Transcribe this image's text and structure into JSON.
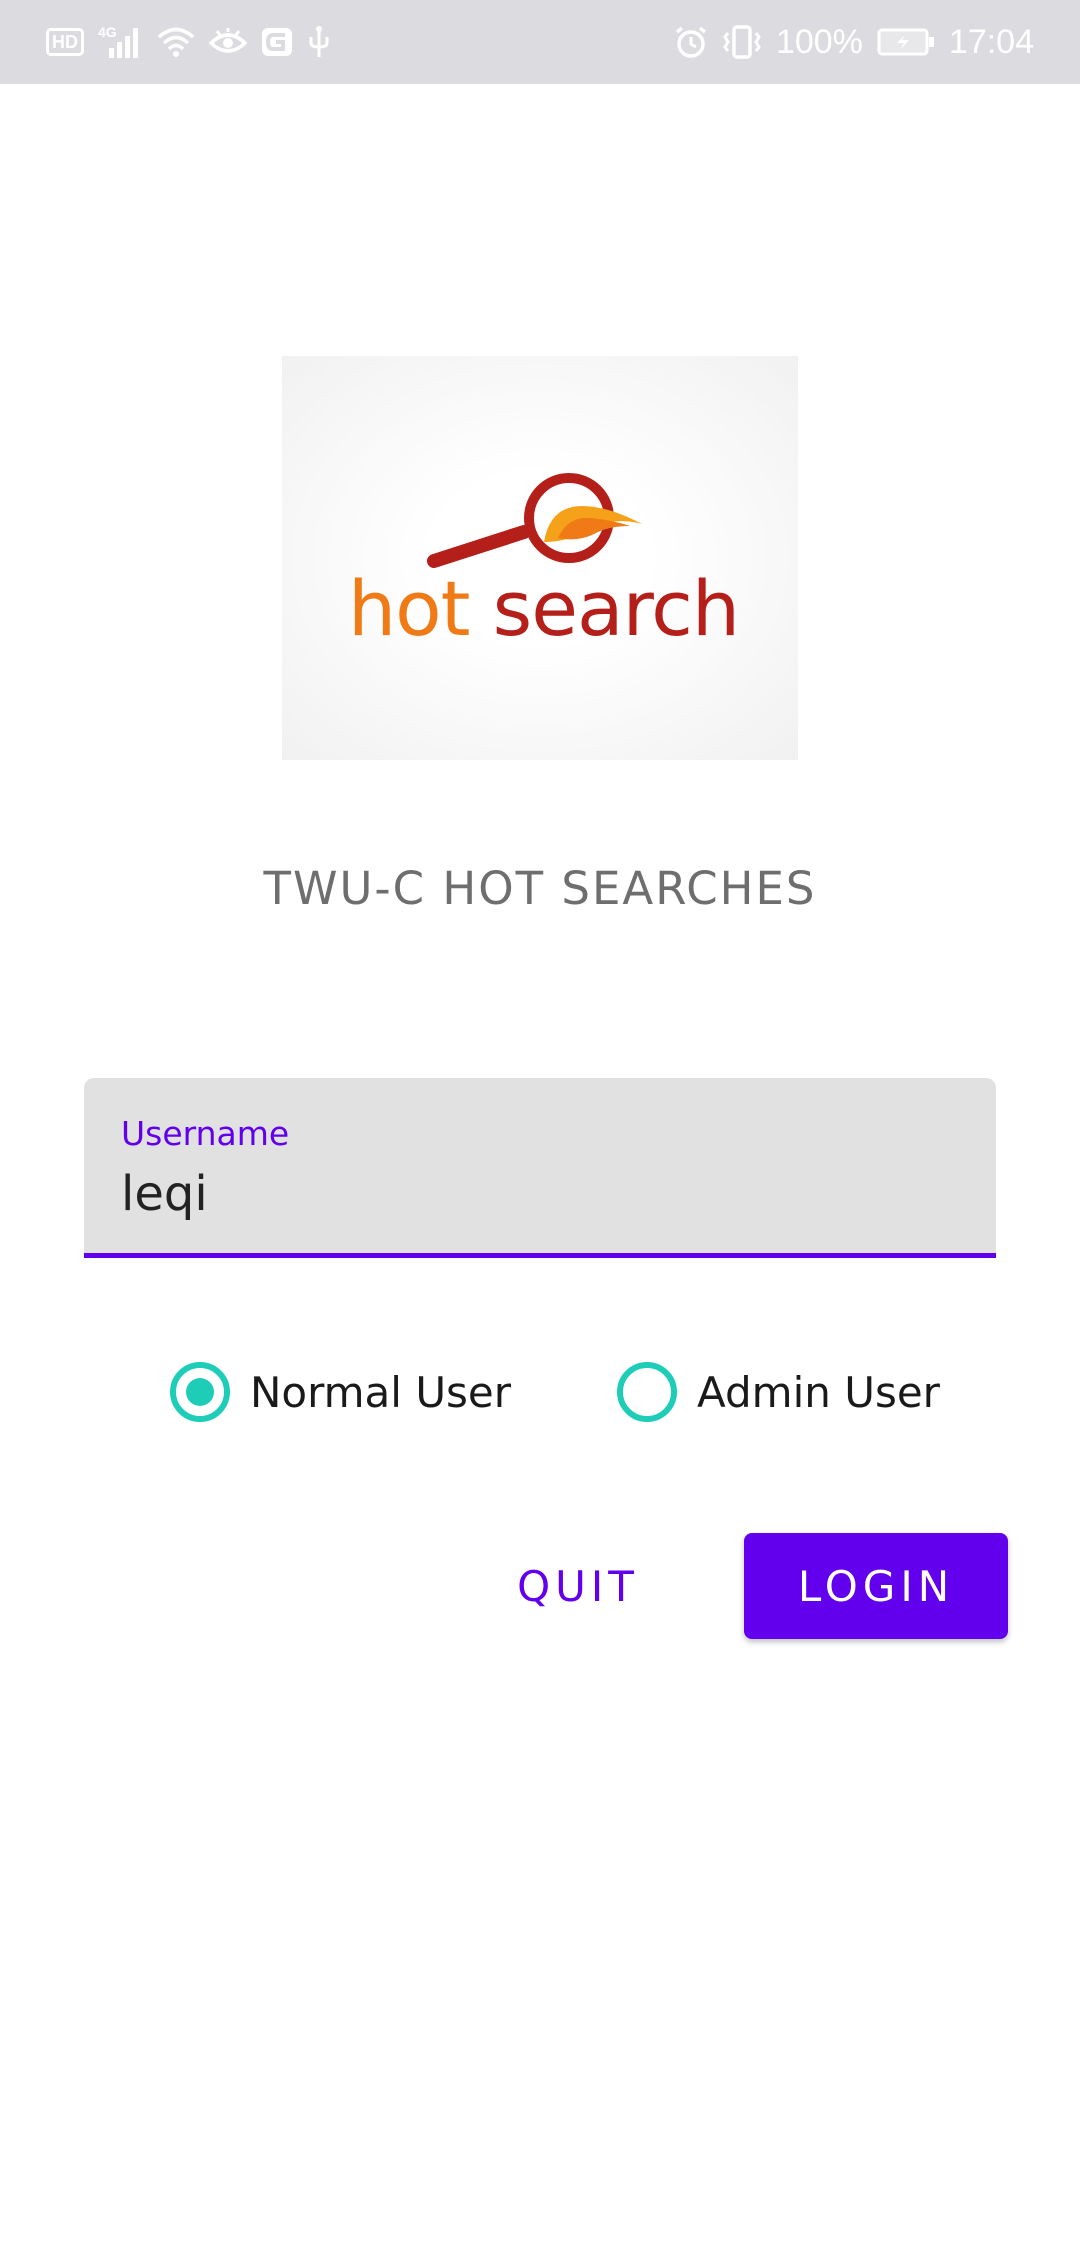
{
  "status_bar": {
    "hd_badge": "HD",
    "network_label": "4G",
    "battery": "100%",
    "time": "17:04",
    "icons_left": [
      "hd-icon",
      "signal-icon",
      "wifi-icon",
      "eye-icon",
      "g-app-icon",
      "usb-icon"
    ],
    "icons_right": [
      "alarm-icon",
      "vibrate-icon",
      "battery-icon"
    ]
  },
  "logo": {
    "word_hot": "hot",
    "word_search": "search",
    "colors": {
      "hot": "#ef7a16",
      "search": "#b51f1a"
    }
  },
  "app_title": "TWU-C HOT SEARCHES",
  "username_field": {
    "label": "Username",
    "value": "leqi"
  },
  "user_type": {
    "options": [
      {
        "label": "Normal User",
        "selected": true
      },
      {
        "label": "Admin User",
        "selected": false
      }
    ]
  },
  "buttons": {
    "quit": "QUIT",
    "login": "LOGIN"
  },
  "colors": {
    "primary": "#6200ee",
    "accent": "#1ecdb8",
    "field_bg": "#e1e1e1",
    "status_bar_bg": "#dcdce0"
  }
}
